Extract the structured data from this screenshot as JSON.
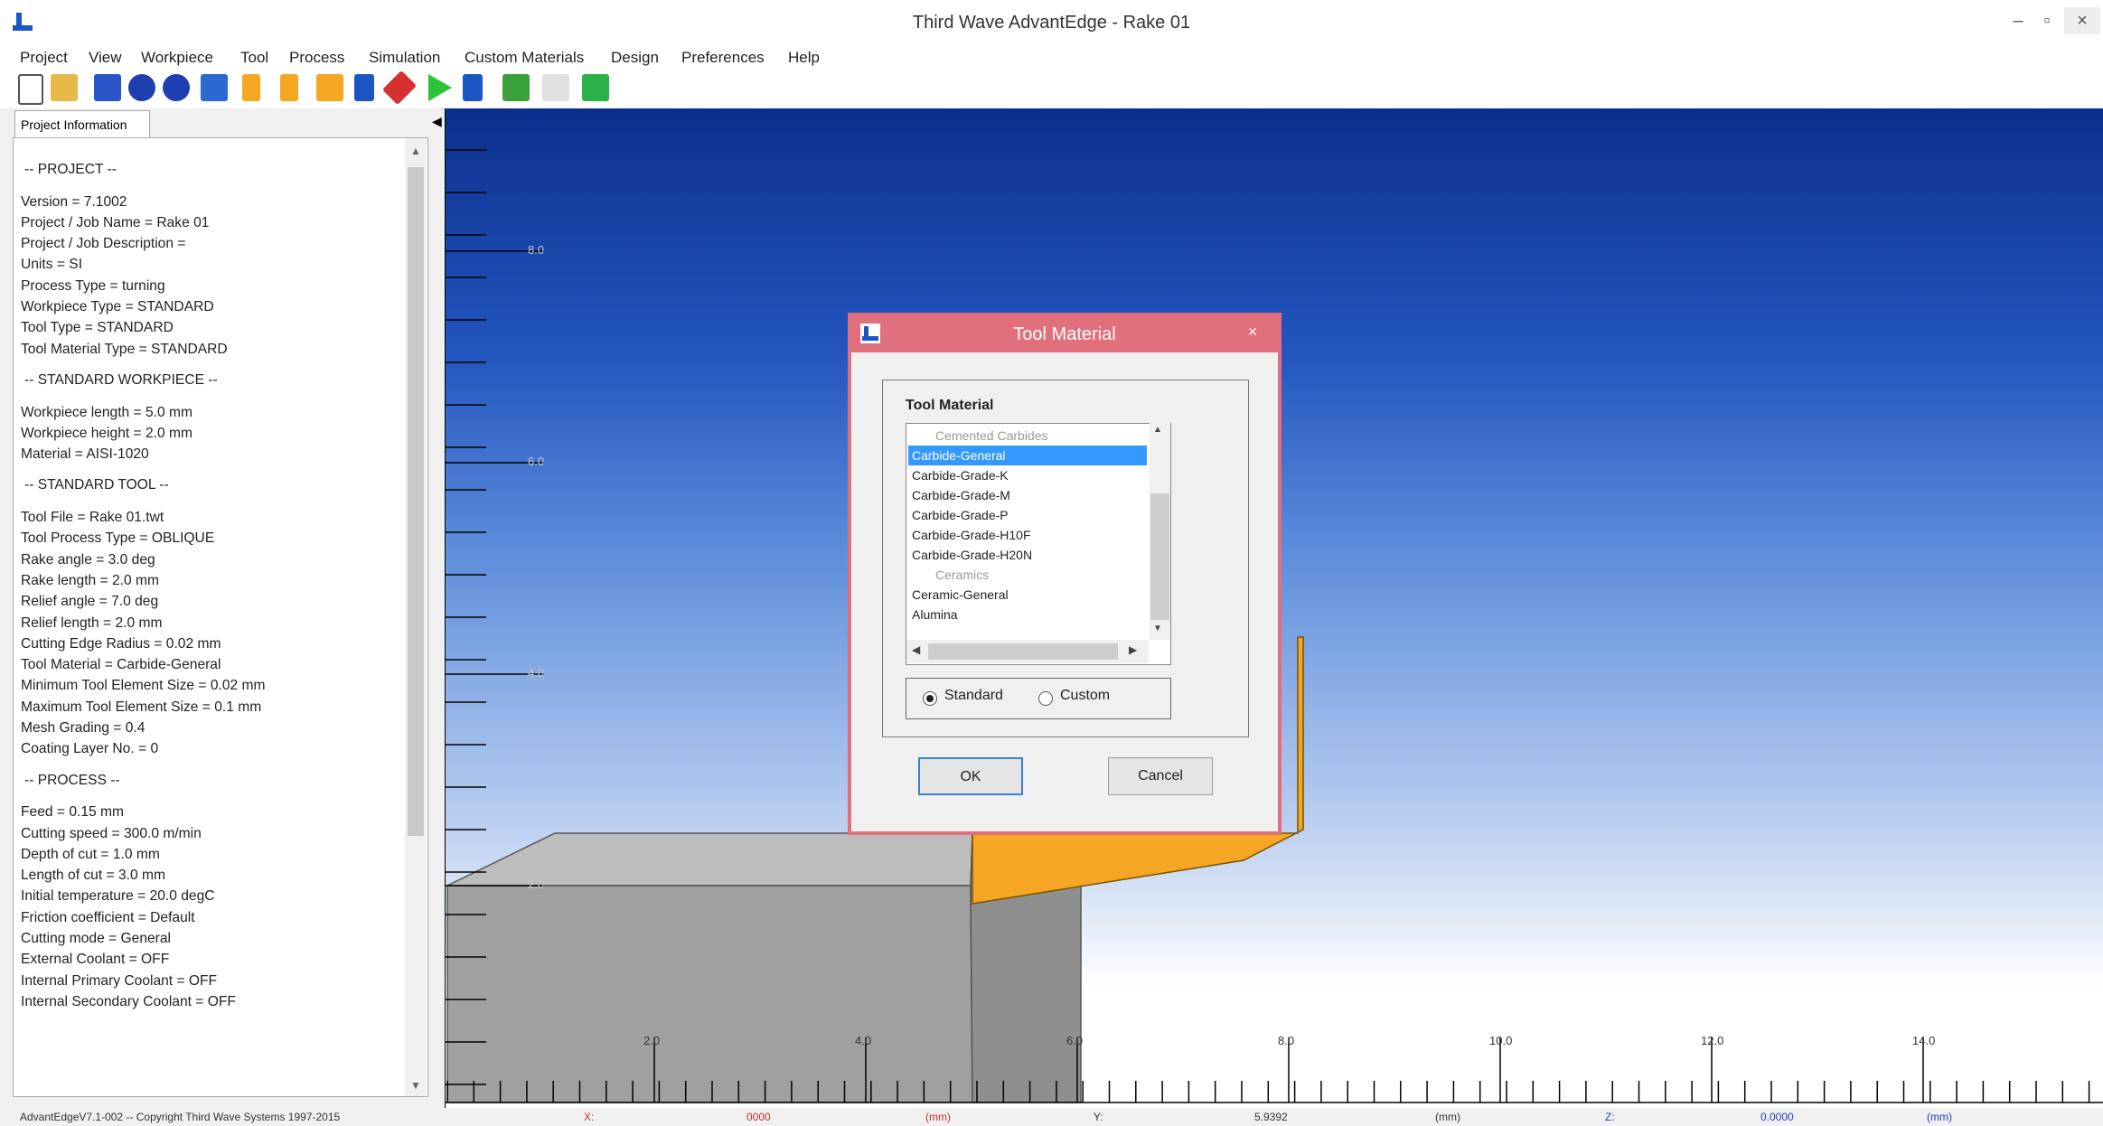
{
  "window": {
    "title": "Third Wave AdvantEdge - Rake 01",
    "minimize": "–",
    "maximize": "▫",
    "close": "×"
  },
  "menu": [
    "Project",
    "View",
    "Workpiece",
    "Tool",
    "Process",
    "Simulation",
    "Custom Materials",
    "Design",
    "Preferences",
    "Help"
  ],
  "toolbar_icons": [
    "new-file-icon",
    "open-folder-icon",
    "save-icon",
    "workpiece-icon",
    "workpiece-icon-2",
    "workpiece-wm-icon",
    "tool-icon",
    "tool-icon-2",
    "tool-tm-icon",
    "process-icon",
    "simulate-icon",
    "run-icon",
    "post-process-icon",
    "job-icon",
    "doe-icon",
    "refresh-icon"
  ],
  "left_panel": {
    "tab_label": "Project Information",
    "lines": [
      {
        "text": "-- PROJECT --",
        "section": true
      },
      {
        "text": "Version = 7.1002"
      },
      {
        "text": "Project / Job Name  = Rake 01"
      },
      {
        "text": "Project / Job Description  ="
      },
      {
        "text": "Units = SI"
      },
      {
        "text": "Process Type = turning"
      },
      {
        "text": "Workpiece Type = STANDARD"
      },
      {
        "text": "Tool Type = STANDARD"
      },
      {
        "text": "Tool Material Type = STANDARD"
      },
      {
        "text": "-- STANDARD WORKPIECE --",
        "section": true
      },
      {
        "text": "Workpiece length = 5.0 mm"
      },
      {
        "text": "Workpiece height = 2.0 mm"
      },
      {
        "text": "Material = AISI-1020"
      },
      {
        "text": "-- STANDARD TOOL --",
        "section": true
      },
      {
        "text": "Tool File = Rake 01.twt"
      },
      {
        "text": "Tool Process Type = OBLIQUE"
      },
      {
        "text": "Rake angle = 3.0 deg"
      },
      {
        "text": "Rake length = 2.0 mm"
      },
      {
        "text": "Relief angle = 7.0 deg"
      },
      {
        "text": "Relief length = 2.0 mm"
      },
      {
        "text": "Cutting Edge Radius = 0.02 mm"
      },
      {
        "text": "Tool Material = Carbide-General"
      },
      {
        "text": "Minimum Tool Element Size = 0.02 mm"
      },
      {
        "text": "Maximum Tool Element Size = 0.1 mm"
      },
      {
        "text": "Mesh Grading = 0.4"
      },
      {
        "text": "Coating Layer No. = 0"
      },
      {
        "text": "-- PROCESS --",
        "section": true
      },
      {
        "text": "Feed = 0.15 mm"
      },
      {
        "text": "Cutting speed = 300.0 m/min"
      },
      {
        "text": "Depth of cut = 1.0 mm"
      },
      {
        "text": "Length of cut = 3.0 mm"
      },
      {
        "text": "Initial temperature = 20.0 degC"
      },
      {
        "text": "Friction coefficient = Default"
      },
      {
        "text": "Cutting mode = General"
      },
      {
        "text": "External Coolant = OFF"
      },
      {
        "text": "Internal Primary Coolant = OFF"
      },
      {
        "text": "Internal Secondary Coolant = OFF"
      }
    ]
  },
  "viewport": {
    "x_ticks": [
      "2.0",
      "4.0",
      "6.0",
      "8.0",
      "10.0",
      "12.0",
      "14.0"
    ],
    "y_ticks": [
      "8.0",
      "6.0",
      "4.0",
      "2.0"
    ],
    "colors": {
      "tool": "#f5a623",
      "workpiece": "#a0a0a0",
      "bg_top": "#0a2f8c",
      "bg_bottom": "#ffffff"
    }
  },
  "dialog": {
    "title": "Tool Material",
    "close": "×",
    "group_label": "Tool Material",
    "items": [
      {
        "text": "Cemented Carbides",
        "category": true
      },
      {
        "text": "Carbide-General",
        "selected": true
      },
      {
        "text": "Carbide-Grade-K"
      },
      {
        "text": "Carbide-Grade-M"
      },
      {
        "text": "Carbide-Grade-P"
      },
      {
        "text": "Carbide-Grade-H10F"
      },
      {
        "text": "Carbide-Grade-H20N"
      },
      {
        "text": "Ceramics",
        "category": true
      },
      {
        "text": "Ceramic-General"
      },
      {
        "text": "Alumina"
      }
    ],
    "radio_standard": "Standard",
    "radio_custom": "Custom",
    "selected_radio": "Standard",
    "ok": "OK",
    "cancel": "Cancel"
  },
  "status": {
    "copyright": "AdvantEdgeV7.1-002 -- Copyright Third Wave Systems 1997-2015",
    "x_label": "X:",
    "x_value": "0000",
    "x_unit": "(mm)",
    "y_label": "Y:",
    "y_value": "5.9392",
    "y_unit": "(mm)",
    "z_label": "Z:",
    "z_value": "0.0000",
    "z_unit": "(mm)"
  }
}
